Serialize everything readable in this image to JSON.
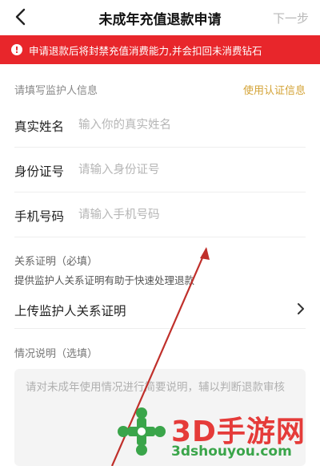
{
  "nav": {
    "title": "未成年充值退款申请",
    "next_label": "下一步",
    "back_icon": "chevron-left-icon"
  },
  "warning": {
    "icon_text": "!",
    "text": "申请退款后将封禁充值消费能力,并会扣回未消费钻石"
  },
  "guardian_section": {
    "title": "请填写监护人信息",
    "use_verified_label": "使用认证信息",
    "fields": [
      {
        "label": "真实姓名",
        "placeholder": "输入你的真实姓名",
        "value": ""
      },
      {
        "label": "身份证号",
        "placeholder": "请输入身份证号",
        "value": ""
      },
      {
        "label": "手机号码",
        "placeholder": "请输入手机号码",
        "value": ""
      }
    ]
  },
  "relation_section": {
    "title": "关系证明（必填）",
    "hint": "提供监护人关系证明有助于快速处理退款",
    "upload_label": "上传监护人关系证明"
  },
  "description_section": {
    "title": "情况说明（选填）",
    "placeholder": "请对未成年使用情况进行简要说明，辅以判断退款审核",
    "value": ""
  },
  "watermark": {
    "brand": "3D手游网",
    "domain": "3dshouyou.com"
  },
  "colors": {
    "warning_bg": "#e8262b",
    "accent_gold": "#d4a336",
    "annotation_arrow": "#c0302b",
    "watermark_red": "#e53b39",
    "watermark_green": "#3aa54a"
  }
}
